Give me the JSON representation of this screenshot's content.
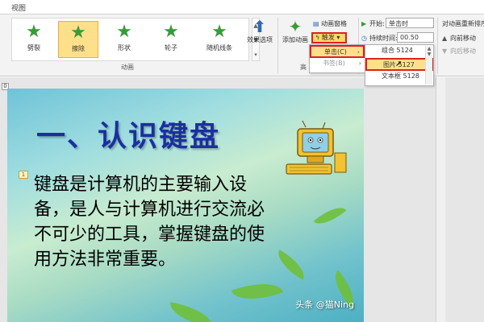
{
  "tabstrip": {
    "view_tab": "视图"
  },
  "gallery": {
    "items": [
      {
        "label": "劈裂",
        "icon": "star-icon"
      },
      {
        "label": "擦除",
        "icon": "star-icon",
        "selected": true
      },
      {
        "label": "形状",
        "icon": "star-icon"
      },
      {
        "label": "轮子",
        "icon": "star-icon"
      },
      {
        "label": "随机线条",
        "icon": "star-icon"
      }
    ],
    "group_label": "动画"
  },
  "effect_options": {
    "label": "效果选项"
  },
  "add_animation": {
    "label": "添加动画"
  },
  "advanced": {
    "group_label": "高",
    "pane_label": "动画窗格",
    "trigger_label": "触发"
  },
  "timing": {
    "start_label": "开始:",
    "start_value": "单击时",
    "duration_label": "持续时间:",
    "duration_value": "00.50"
  },
  "reorder": {
    "title": "对动画重新排序",
    "forward": "向前移动",
    "backward": "向后移动"
  },
  "trigger_menu": {
    "items": [
      {
        "label": "单击(C)",
        "active": true
      },
      {
        "label": "书签(B)",
        "disabled": true
      }
    ]
  },
  "click_submenu": {
    "items": [
      {
        "label": "组合 5124"
      },
      {
        "label": "图片 5127",
        "active": true
      },
      {
        "label": "文本框 5128"
      }
    ]
  },
  "slide": {
    "number": "0",
    "title": "一、认识键盘",
    "anim_marker": "1",
    "body": "键盘是计算机的主要输入设备，是人与计算机进行交流必不可少的工具，掌握键盘的使用方法非常重要。"
  },
  "watermark": "头条 @猫Ning",
  "colors": {
    "title": "#1b2fa0",
    "highlight": "#ffe08a",
    "red_box": "#e02020"
  }
}
